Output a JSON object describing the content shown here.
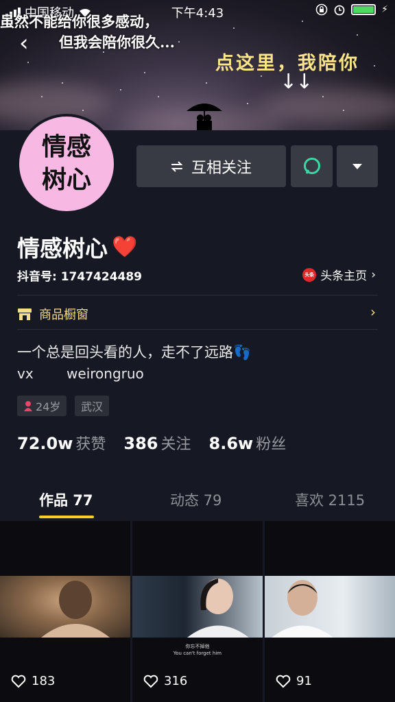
{
  "status_bar": {
    "carrier": "中国移动",
    "time": "下午4:43"
  },
  "banner": {
    "line1": "虽然不能给你很多感动，",
    "line2": "但我会陪你很久...",
    "line3": "点这里，我陪你",
    "arrows": "↓↓"
  },
  "avatar": {
    "line1": "情感",
    "line2": "树心"
  },
  "actions": {
    "follow_label": "互相关注"
  },
  "profile": {
    "name": "情感树心",
    "heart": "❤️",
    "douyin_id": "抖音号: 1747424489",
    "toutiao_label": "头条主页",
    "toutiao_badge": "头条",
    "shop_label": "商品橱窗",
    "bio_line1": "一个总是回头看的人，走不了远路👣",
    "bio_line2_a": "vx",
    "bio_line2_b": "weirongruo",
    "tags": [
      "24岁",
      "武汉"
    ]
  },
  "stats": [
    {
      "value": "72.0w",
      "label": "获赞"
    },
    {
      "value": "386",
      "label": "关注"
    },
    {
      "value": "8.6w",
      "label": "粉丝"
    }
  ],
  "tabs": [
    {
      "label": "作品 77",
      "active": true
    },
    {
      "label": "动态 79",
      "active": false
    },
    {
      "label": "喜欢 2115",
      "active": false
    }
  ],
  "videos": [
    {
      "likes": "183"
    },
    {
      "likes": "316",
      "caption_cn": "你忘不掉他",
      "caption_en": "You can't forget him"
    },
    {
      "likes": "91"
    }
  ],
  "colors": {
    "background": "#161823",
    "accent_yellow": "#fbcc2c",
    "shop_gold": "#f5dc8c",
    "avatar_pink": "#f7b8e3"
  }
}
